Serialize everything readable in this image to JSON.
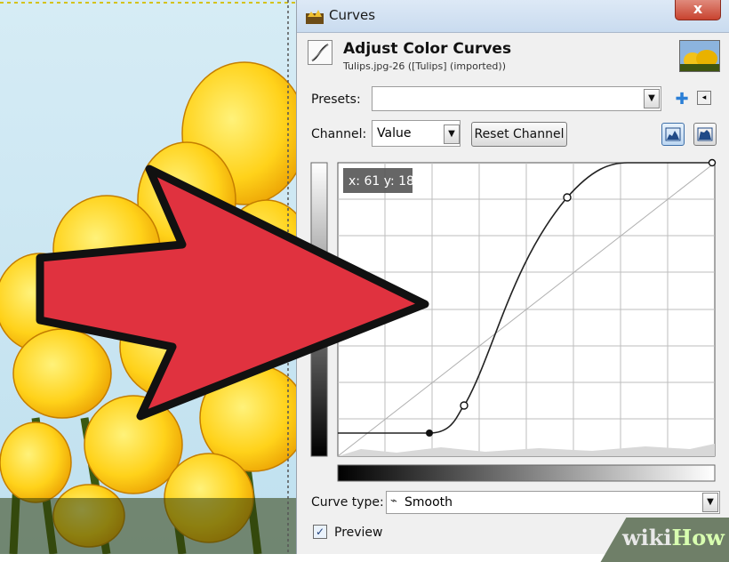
{
  "window": {
    "title": "Curves",
    "close_label": "x"
  },
  "header": {
    "title": "Adjust Color Curves",
    "subtitle": "Tulips.jpg-26 ([Tulips] (imported))"
  },
  "presets": {
    "label": "Presets:",
    "value": ""
  },
  "channel": {
    "label": "Channel:",
    "value": "Value",
    "reset_label": "Reset Channel"
  },
  "graph": {
    "readout": "x: 61 y: 18"
  },
  "curve_type": {
    "label": "Curve type:",
    "value": "Smooth"
  },
  "preview": {
    "label": "Preview",
    "checked": true
  },
  "watermark": {
    "wiki": "wiki",
    "how": "How"
  },
  "colors": {
    "arrow_fill": "#e0323f",
    "arrow_stroke": "#111111",
    "sky": "#cfe6f2",
    "tulip": "#ffd21a"
  }
}
